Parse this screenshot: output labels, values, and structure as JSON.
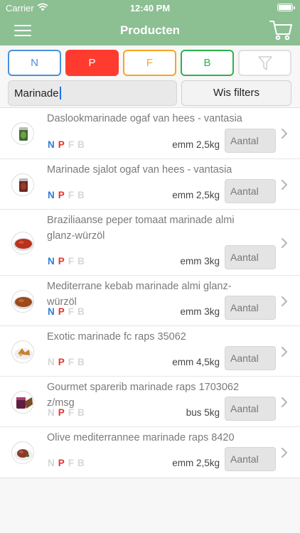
{
  "status": {
    "carrier": "Carrier",
    "time": "12:40 PM"
  },
  "header": {
    "title": "Producten"
  },
  "filters": {
    "n_label": "N",
    "p_label": "P",
    "f_label": "F",
    "b_label": "B",
    "search_value": "Marinade",
    "clear_label": "Wis filters"
  },
  "colors": {
    "accent": "#8cbf92",
    "n": "#4a90d9",
    "p": "#ff3b30",
    "f": "#f5a623",
    "b": "#2bb34b"
  },
  "products": [
    {
      "name": "Daslookmarinade ogaf van hees - vantasia",
      "n": "N",
      "p": "P",
      "f": "F",
      "b": "B",
      "n_on": true,
      "p_on": true,
      "unit": "emm 2,5kg",
      "qty_placeholder": "Aantal",
      "thumb": "jar-green"
    },
    {
      "name": "Marinade sjalot ogaf van hees - vantasia",
      "n": "N",
      "p": "P",
      "f": "F",
      "b": "B",
      "n_on": true,
      "p_on": true,
      "unit": "emm 2,5kg",
      "qty_placeholder": "Aantal",
      "thumb": "jar-red"
    },
    {
      "name": "Braziliaanse peper tomaat marinade almi glanz-würzöl",
      "n": "N",
      "p": "P",
      "f": "F",
      "b": "B",
      "n_on": true,
      "p_on": true,
      "unit": "emm 3kg",
      "qty_placeholder": "Aantal",
      "thumb": "bowl-red"
    },
    {
      "name": "Mediterrane kebab marinade almi glanz-würzöl",
      "n": "N",
      "p": "P",
      "f": "F",
      "b": "B",
      "n_on": true,
      "p_on": true,
      "unit": "emm 3kg",
      "qty_placeholder": "Aantal",
      "thumb": "bowl-brown"
    },
    {
      "name": "Exotic marinade fc raps 35062",
      "n": "N",
      "p": "P",
      "f": "F",
      "b": "B",
      "n_on": false,
      "p_on": true,
      "unit": "emm 4,5kg",
      "qty_placeholder": "Aantal",
      "thumb": "plate-food"
    },
    {
      "name": "Gourmet sparerib marinade raps 1703062 z/msg",
      "n": "N",
      "p": "P",
      "f": "F",
      "b": "B",
      "n_on": false,
      "p_on": true,
      "unit": "bus 5kg",
      "qty_placeholder": "Aantal",
      "thumb": "ribs"
    },
    {
      "name": "Olive mediterrannee marinade raps 8420",
      "n": "N",
      "p": "P",
      "f": "F",
      "b": "B",
      "n_on": false,
      "p_on": true,
      "unit": "emm 2,5kg",
      "qty_placeholder": "Aantal",
      "thumb": "plate-meat"
    }
  ]
}
